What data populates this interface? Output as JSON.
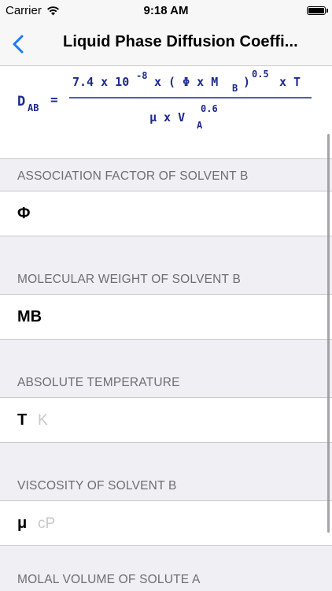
{
  "status_bar": {
    "carrier": "Carrier",
    "time": "9:18 AM"
  },
  "nav": {
    "title": "Liquid Phase Diffusion Coeffi..."
  },
  "formula": {
    "lhs": "D",
    "lhs_sub": "AB",
    "equals": "=",
    "numerator_a": "7.4 x 10",
    "numerator_exp": "-8",
    "numerator_b": "x ( Φ x M",
    "numerator_sub": "B",
    "numerator_c": ")",
    "numerator_pow": "0.5",
    "numerator_d": "x T",
    "denominator_a": "μ x V",
    "denominator_sub": "A",
    "denominator_pow": "0.6"
  },
  "sections": [
    {
      "header": "ASSOCIATION FACTOR OF SOLVENT B",
      "symbol": "Φ",
      "unit": ""
    },
    {
      "header": "MOLECULAR WEIGHT OF SOLVENT B",
      "symbol": "MB",
      "unit": ""
    },
    {
      "header": "ABSOLUTE TEMPERATURE",
      "symbol": "T",
      "unit": "K"
    },
    {
      "header": "VISCOSITY OF SOLVENT B",
      "symbol": "μ",
      "unit": "cP"
    },
    {
      "header": "MOLAL VOLUME OF SOLUTE A",
      "symbol": "",
      "unit": ""
    }
  ],
  "colors": {
    "accent": "#1a7bf2",
    "formula_text": "#1c2a8c",
    "section_header": "#6d6d72",
    "placeholder": "#c7c7cd"
  }
}
